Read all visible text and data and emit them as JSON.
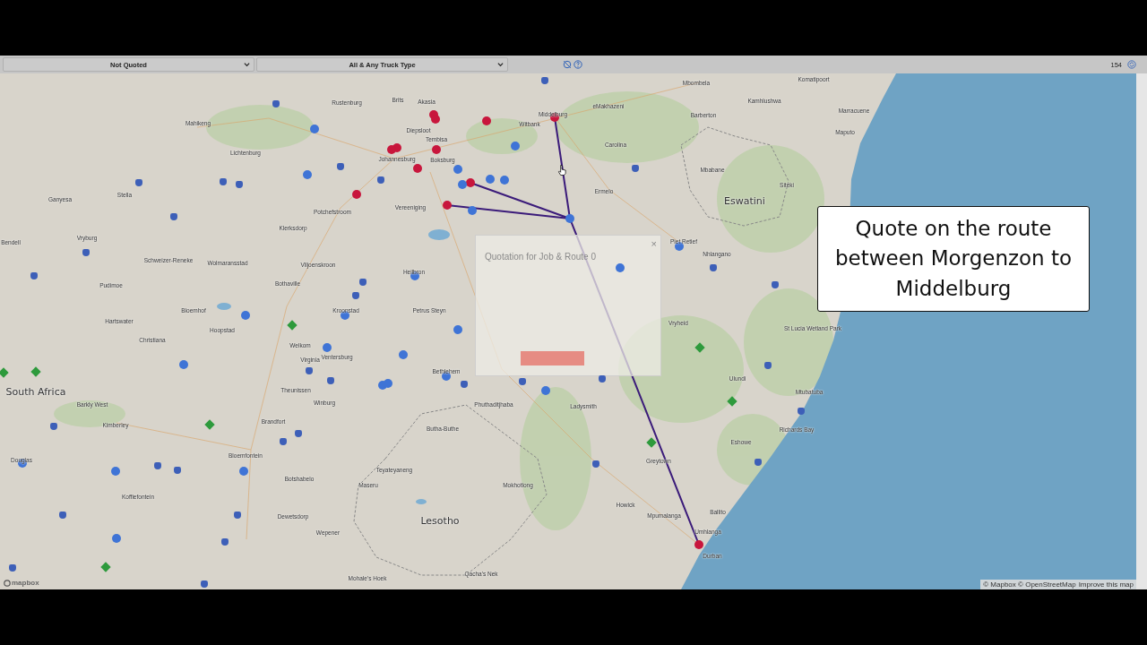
{
  "toolbar": {
    "status_filter": "Not Quoted",
    "truck_filter": "All & Any Truck Type",
    "count": "154"
  },
  "map": {
    "labels": [
      {
        "text": "Rustenburg",
        "kind": "city"
      },
      {
        "text": "Brits",
        "kind": "city"
      },
      {
        "text": "Akasia",
        "kind": "city"
      },
      {
        "text": "Diepsloot",
        "kind": "city"
      },
      {
        "text": "Tembisa",
        "kind": "city"
      },
      {
        "text": "Johannesburg",
        "kind": "city"
      },
      {
        "text": "Boksburg",
        "kind": "city"
      },
      {
        "text": "Witbank",
        "kind": "city"
      },
      {
        "text": "Middelburg",
        "kind": "city"
      },
      {
        "text": "eMakhazeni",
        "kind": "city"
      },
      {
        "text": "Mbombela",
        "kind": "city"
      },
      {
        "text": "Komatipoort",
        "kind": "city"
      },
      {
        "text": "Barberton",
        "kind": "city"
      },
      {
        "text": "Kamhlushwa",
        "kind": "city"
      },
      {
        "text": "Marracuene",
        "kind": "city"
      },
      {
        "text": "Maputo",
        "kind": "city"
      },
      {
        "text": "Carolina",
        "kind": "city"
      },
      {
        "text": "Mbabane",
        "kind": "city"
      },
      {
        "text": "Siteki",
        "kind": "city"
      },
      {
        "text": "Eswatini",
        "kind": "country"
      },
      {
        "text": "Ermelo",
        "kind": "city"
      },
      {
        "text": "Vereeniging",
        "kind": "city"
      },
      {
        "text": "Potchefstroom",
        "kind": "city"
      },
      {
        "text": "Klerksdorp",
        "kind": "city"
      },
      {
        "text": "Lichtenburg",
        "kind": "city"
      },
      {
        "text": "Mahikeng",
        "kind": "city"
      },
      {
        "text": "Ganyesa",
        "kind": "city"
      },
      {
        "text": "Stella",
        "kind": "city"
      },
      {
        "text": "Vryburg",
        "kind": "city"
      },
      {
        "text": "Bendell",
        "kind": "city"
      },
      {
        "text": "Schweizer-Reneke",
        "kind": "city"
      },
      {
        "text": "Wolmaransstad",
        "kind": "city"
      },
      {
        "text": "Viljoenskroon",
        "kind": "city"
      },
      {
        "text": "Heilbron",
        "kind": "city"
      },
      {
        "text": "Bothaville",
        "kind": "city"
      },
      {
        "text": "Kroonstad",
        "kind": "city"
      },
      {
        "text": "Petrus Steyn",
        "kind": "city"
      },
      {
        "text": "Pudimoe",
        "kind": "city"
      },
      {
        "text": "Hartswater",
        "kind": "city"
      },
      {
        "text": "Bloemhof",
        "kind": "city"
      },
      {
        "text": "Christiana",
        "kind": "city"
      },
      {
        "text": "Hoopstad",
        "kind": "city"
      },
      {
        "text": "Welkom",
        "kind": "city"
      },
      {
        "text": "Virginia",
        "kind": "city"
      },
      {
        "text": "Ventersburg",
        "kind": "city"
      },
      {
        "text": "Bethlehem",
        "kind": "city"
      },
      {
        "text": "South Africa",
        "kind": "country"
      },
      {
        "text": "Theunissen",
        "kind": "city"
      },
      {
        "text": "Barkly West",
        "kind": "city"
      },
      {
        "text": "Winburg",
        "kind": "city"
      },
      {
        "text": "Kimberley",
        "kind": "city"
      },
      {
        "text": "Brandfort",
        "kind": "city"
      },
      {
        "text": "Bloemfontein",
        "kind": "city"
      },
      {
        "text": "Botshabelo",
        "kind": "city"
      },
      {
        "text": "Douglas",
        "kind": "city"
      },
      {
        "text": "Koffiefontein",
        "kind": "city"
      },
      {
        "text": "Dewetsdorp",
        "kind": "city"
      },
      {
        "text": "Maseru",
        "kind": "city"
      },
      {
        "text": "Teyateyaneng",
        "kind": "city"
      },
      {
        "text": "Butha-Buthe",
        "kind": "city"
      },
      {
        "text": "Mokhotlong",
        "kind": "city"
      },
      {
        "text": "Lesotho",
        "kind": "country"
      },
      {
        "text": "Phuthaditjhaba",
        "kind": "city"
      },
      {
        "text": "Ladysmith",
        "kind": "city"
      },
      {
        "text": "Piet Retief",
        "kind": "city"
      },
      {
        "text": "Nhlangano",
        "kind": "city"
      },
      {
        "text": "Vryheid",
        "kind": "city"
      },
      {
        "text": "St Lucia Wetland Park",
        "kind": "city"
      },
      {
        "text": "Ulundi",
        "kind": "city"
      },
      {
        "text": "Mtubatuba",
        "kind": "city"
      },
      {
        "text": "Richards Bay",
        "kind": "city"
      },
      {
        "text": "Eshowe",
        "kind": "city"
      },
      {
        "text": "Greytown",
        "kind": "city"
      },
      {
        "text": "Howick",
        "kind": "city"
      },
      {
        "text": "Ballito",
        "kind": "city"
      },
      {
        "text": "Mpumalanga",
        "kind": "city"
      },
      {
        "text": "Umhlanga",
        "kind": "city"
      },
      {
        "text": "Durban",
        "kind": "city"
      },
      {
        "text": "Mohale's Hoek",
        "kind": "city"
      },
      {
        "text": "Qacha's Nek",
        "kind": "city"
      },
      {
        "text": "Wepener",
        "kind": "city"
      }
    ],
    "markers": [
      {
        "kind": "dot",
        "color": "#c8163c"
      },
      {
        "kind": "dot",
        "color": "#c8163c"
      },
      {
        "kind": "dot",
        "color": "#c8163c"
      },
      {
        "kind": "dot",
        "color": "#c8163c"
      },
      {
        "kind": "dot",
        "color": "#c8163c"
      },
      {
        "kind": "dot",
        "color": "#c8163c"
      },
      {
        "kind": "dot",
        "color": "#c8163c"
      },
      {
        "kind": "dot",
        "color": "#c8163c"
      },
      {
        "kind": "dot",
        "color": "#c8163c"
      },
      {
        "kind": "dot",
        "color": "#c8163c"
      },
      {
        "kind": "dot",
        "color": "#c8163c"
      },
      {
        "kind": "dot",
        "color": "#c8163c"
      },
      {
        "kind": "dot",
        "color": "#3f74d6"
      },
      {
        "kind": "dot",
        "color": "#3f74d6"
      },
      {
        "kind": "dot",
        "color": "#3f74d6"
      },
      {
        "kind": "dot",
        "color": "#3f74d6"
      },
      {
        "kind": "dot",
        "color": "#3f74d6"
      },
      {
        "kind": "dot",
        "color": "#3f74d6"
      },
      {
        "kind": "dot",
        "color": "#3f74d6"
      },
      {
        "kind": "dot",
        "color": "#3f74d6"
      },
      {
        "kind": "dot",
        "color": "#3f74d6"
      },
      {
        "kind": "dot",
        "color": "#3f74d6"
      },
      {
        "kind": "dot",
        "color": "#3f74d6"
      },
      {
        "kind": "dot",
        "color": "#3f74d6"
      },
      {
        "kind": "dot",
        "color": "#3f74d6"
      },
      {
        "kind": "dot",
        "color": "#3f74d6"
      },
      {
        "kind": "dot",
        "color": "#3f74d6"
      },
      {
        "kind": "dot",
        "color": "#3f74d6"
      },
      {
        "kind": "dot",
        "color": "#3f74d6"
      },
      {
        "kind": "dot",
        "color": "#3f74d6"
      },
      {
        "kind": "dot",
        "color": "#3f74d6"
      },
      {
        "kind": "dot",
        "color": "#3f74d6"
      },
      {
        "kind": "dot",
        "color": "#3f74d6"
      },
      {
        "kind": "dot",
        "color": "#3f74d6"
      },
      {
        "kind": "dot",
        "color": "#3f74d6"
      },
      {
        "kind": "dot",
        "color": "#3f74d6"
      },
      {
        "kind": "dot",
        "color": "#3f74d6"
      },
      {
        "kind": "dot",
        "color": "#3f74d6"
      },
      {
        "kind": "pin",
        "color": "#3d5fb8"
      },
      {
        "kind": "pin",
        "color": "#3d5fb8"
      },
      {
        "kind": "pin",
        "color": "#3d5fb8"
      },
      {
        "kind": "pin",
        "color": "#3d5fb8"
      },
      {
        "kind": "pin",
        "color": "#3d5fb8"
      },
      {
        "kind": "pin",
        "color": "#3d5fb8"
      },
      {
        "kind": "pin",
        "color": "#3d5fb8"
      },
      {
        "kind": "pin",
        "color": "#3d5fb8"
      },
      {
        "kind": "pin",
        "color": "#3d5fb8"
      },
      {
        "kind": "pin",
        "color": "#3d5fb8"
      },
      {
        "kind": "pin",
        "color": "#3d5fb8"
      },
      {
        "kind": "pin",
        "color": "#3d5fb8"
      },
      {
        "kind": "pin",
        "color": "#3d5fb8"
      },
      {
        "kind": "pin",
        "color": "#3d5fb8"
      },
      {
        "kind": "pin",
        "color": "#3d5fb8"
      },
      {
        "kind": "pin",
        "color": "#3d5fb8"
      },
      {
        "kind": "pin",
        "color": "#3d5fb8"
      },
      {
        "kind": "pin",
        "color": "#3d5fb8"
      },
      {
        "kind": "pin",
        "color": "#3d5fb8"
      },
      {
        "kind": "pin",
        "color": "#3d5fb8"
      },
      {
        "kind": "pin",
        "color": "#3d5fb8"
      },
      {
        "kind": "pin",
        "color": "#3d5fb8"
      },
      {
        "kind": "pin",
        "color": "#3d5fb8"
      },
      {
        "kind": "pin",
        "color": "#3d5fb8"
      },
      {
        "kind": "pin",
        "color": "#3d5fb8"
      },
      {
        "kind": "pin",
        "color": "#3d5fb8"
      },
      {
        "kind": "pin",
        "color": "#3d5fb8"
      },
      {
        "kind": "pin",
        "color": "#3d5fb8"
      },
      {
        "kind": "pin",
        "color": "#3d5fb8"
      },
      {
        "kind": "pin",
        "color": "#3d5fb8"
      },
      {
        "kind": "pin",
        "color": "#3d5fb8"
      },
      {
        "kind": "pin",
        "color": "#3d5fb8"
      },
      {
        "kind": "pin",
        "color": "#3d5fb8"
      },
      {
        "kind": "pin",
        "color": "#3d5fb8"
      },
      {
        "kind": "diamond",
        "color": "#2e9a3c"
      },
      {
        "kind": "diamond",
        "color": "#2e9a3c"
      },
      {
        "kind": "diamond",
        "color": "#2e9a3c"
      },
      {
        "kind": "diamond",
        "color": "#2e9a3c"
      },
      {
        "kind": "diamond",
        "color": "#2e9a3c"
      },
      {
        "kind": "diamond",
        "color": "#2e9a3c"
      },
      {
        "kind": "diamond",
        "color": "#2e9a3c"
      },
      {
        "kind": "diamond",
        "color": "#2e9a3c"
      }
    ],
    "dialog": {
      "title": "Quotation for Job & Route 0",
      "close": "×"
    },
    "caption": "Quote on the route between Morgenzon to Middelburg",
    "attribution": "© Mapbox © OpenStreetMap",
    "improve_link": "Improve this map",
    "logo": "mapbox"
  }
}
